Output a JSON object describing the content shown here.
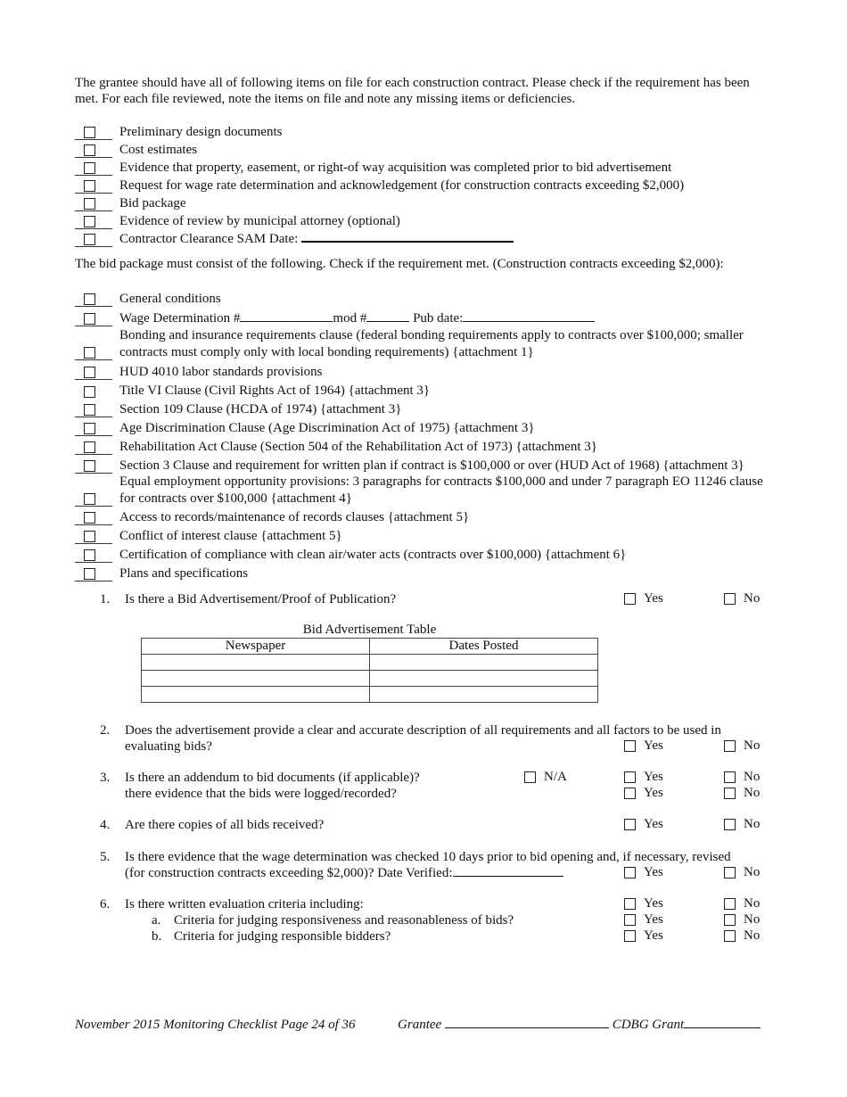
{
  "intro_1": "The grantee should have all of following items on file for each construction contract. Please check if the requirement has been met.  For each file reviewed, note the items on file and note any missing items or deficiencies.",
  "file_items": [
    {
      "label": "Preliminary design documents",
      "checked": false
    },
    {
      "label": "Cost estimates",
      "checked": false
    },
    {
      "label": "Evidence that property, easement, or right-of way acquisition was completed prior to bid advertisement",
      "checked": false
    },
    {
      "label": "Request for wage rate determination and acknowledgement (for construction contracts exceeding $2,000)",
      "checked": false
    },
    {
      "label": "Bid package",
      "checked": false
    },
    {
      "label": "Evidence of review by municipal attorney (optional)",
      "checked": false
    },
    {
      "label": "Contractor Clearance SAM Date:",
      "checked": false,
      "value": ""
    }
  ],
  "intro_2": "The bid package must consist of the following.  Check if the requirement met. (Construction contracts exceeding $2,000):",
  "bid_items": [
    {
      "label": "General conditions"
    },
    {
      "label_a": "Wage Determination #",
      "label_b": "mod #",
      "label_c": " Pub date:",
      "wage_det": "",
      "mod": "",
      "pub_date": ""
    },
    {
      "label": "Bonding and insurance requirements clause (federal bonding requirements apply to contracts over $100,000; smaller contracts must comply only with local bonding requirements) {attachment 1}"
    },
    {
      "label": "HUD 4010 labor standards provisions"
    },
    {
      "label": "Title VI Clause (Civil Rights Act of 1964) {attachment 3}"
    },
    {
      "label": "Section 109 Clause (HCDA of 1974) {attachment 3}"
    },
    {
      "label": "Age Discrimination Clause (Age Discrimination Act of 1975) {attachment 3}"
    },
    {
      "label": "Rehabilitation Act Clause (Section 504 of the Rehabilitation Act of 1973) {attachment 3}"
    },
    {
      "label": "Section 3 Clause and requirement for written plan if contract is $100,000 or over (HUD Act of 1968) {attachment 3}"
    },
    {
      "label": "Equal employment opportunity provisions: 3 paragraphs for contracts $100,000 and under 7 paragraph EO 11246 clause for contracts over $100,000 {attachment 4}"
    },
    {
      "label": "Access to records/maintenance of records clauses {attachment 5}"
    },
    {
      "label": "Conflict of interest clause {attachment 5}"
    },
    {
      "label": "Certification of compliance with clean air/water acts (contracts over $100,000) {attachment 6}"
    },
    {
      "label": "Plans and specifications"
    }
  ],
  "options": {
    "yes": "Yes",
    "no": "No",
    "na": "N/A"
  },
  "questions": {
    "q1": {
      "num": "1.",
      "text": "Is there a Bid Advertisement/Proof of Publication?"
    },
    "q2": {
      "num": "2.",
      "text": "Does the advertisement provide a clear and accurate description of all requirements and all factors to be used in evaluating bids?"
    },
    "q3": {
      "num": "3.",
      "text": "Is there an addendum to bid documents (if applicable)?",
      "text_b": "there evidence that the bids were logged/recorded?"
    },
    "q4": {
      "num": "4.",
      "text": "Are there copies of all bids received?"
    },
    "q5": {
      "num": "5.",
      "text_a": "Is there evidence that the wage determination was checked 10 days prior to bid opening and, if necessary, revised",
      "text_b": "(for construction contracts exceeding $2,000)? Date Verified:",
      "date_verified": ""
    },
    "q6": {
      "num": "6.",
      "text": "Is there written evaluation criteria including:",
      "subs": [
        {
          "letter": "a.",
          "text": "Criteria for judging responsiveness and reasonableness of bids?"
        },
        {
          "letter": "b.",
          "text": "Criteria for judging responsible bidders?"
        }
      ]
    }
  },
  "bid_table": {
    "title": "Bid Advertisement Table",
    "columns": [
      "Newspaper",
      "Dates Posted"
    ],
    "rows": [
      [
        "",
        ""
      ],
      [
        "",
        ""
      ],
      [
        "",
        ""
      ]
    ]
  },
  "footer": {
    "left": "November 2015 Monitoring Checklist Page 24 of 36",
    "grantee_label": "Grantee",
    "grantee_value": "",
    "grant_label": "CDBG Grant",
    "grant_value": ""
  }
}
